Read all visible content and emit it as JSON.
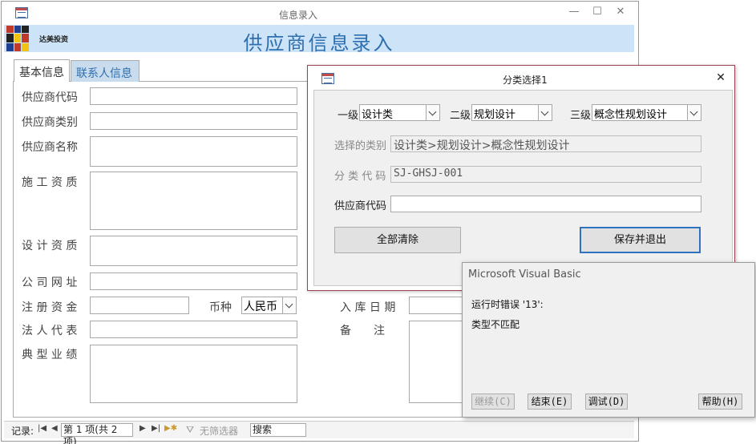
{
  "main_window": {
    "title": "信息录入",
    "controls": {
      "minimize": "—",
      "maximize": "☐",
      "close": "✕"
    }
  },
  "header": {
    "brand": "达美投资",
    "form_title": "供应商信息录入",
    "logo_colors": [
      "#c0392b",
      "#1f3f8f",
      "#f1c40f",
      "#222222",
      "#ffffff"
    ]
  },
  "tabs": [
    {
      "label": "基本信息",
      "active": true
    },
    {
      "label": "联系人信息",
      "active": false
    }
  ],
  "form": {
    "supplier_code": "供应商代码",
    "supplier_category": "供应商类别",
    "supplier_name": "供应商名称",
    "construction_qualification": "施 工 资 质",
    "design_qualification": "设 计 资 质",
    "website": "公 司 网 址",
    "registered_capital": "注 册 资 金",
    "currency_label": "币种",
    "currency_value": "人民币",
    "legal_rep": "法 人 代 表",
    "typical_projects": "典 型 业 绩",
    "entry_date": "入 库 日 期",
    "remarks": "备　　注"
  },
  "record_nav": {
    "label": "记录:",
    "position": "第 1 项(共 2 项)",
    "filter": "无筛选器",
    "search": "搜索"
  },
  "category_dialog": {
    "title": "分类选择1",
    "level1_label": "一级",
    "level1_value": "设计类",
    "level2_label": "二级",
    "level2_value": "规划设计",
    "level3_label": "三级",
    "level3_value": "概念性规划设计",
    "selected_label": "选择的类别",
    "selected_value": "设计类>规划设计>概念性规划设计",
    "code_label": "分 类 代 码",
    "code_value": "SJ-GHSJ-001",
    "supplier_code_label": "供应商代码",
    "clear_button": "全部清除",
    "save_button": "保存并退出",
    "close": "✕"
  },
  "vb_error": {
    "title": "Microsoft Visual Basic",
    "line1": "运行时错误 '13':",
    "line2": "类型不匹配",
    "continue_button": "继续(C)",
    "end_button": "结束(E)",
    "debug_button": "调试(D)",
    "help_button": "帮助(H)"
  }
}
